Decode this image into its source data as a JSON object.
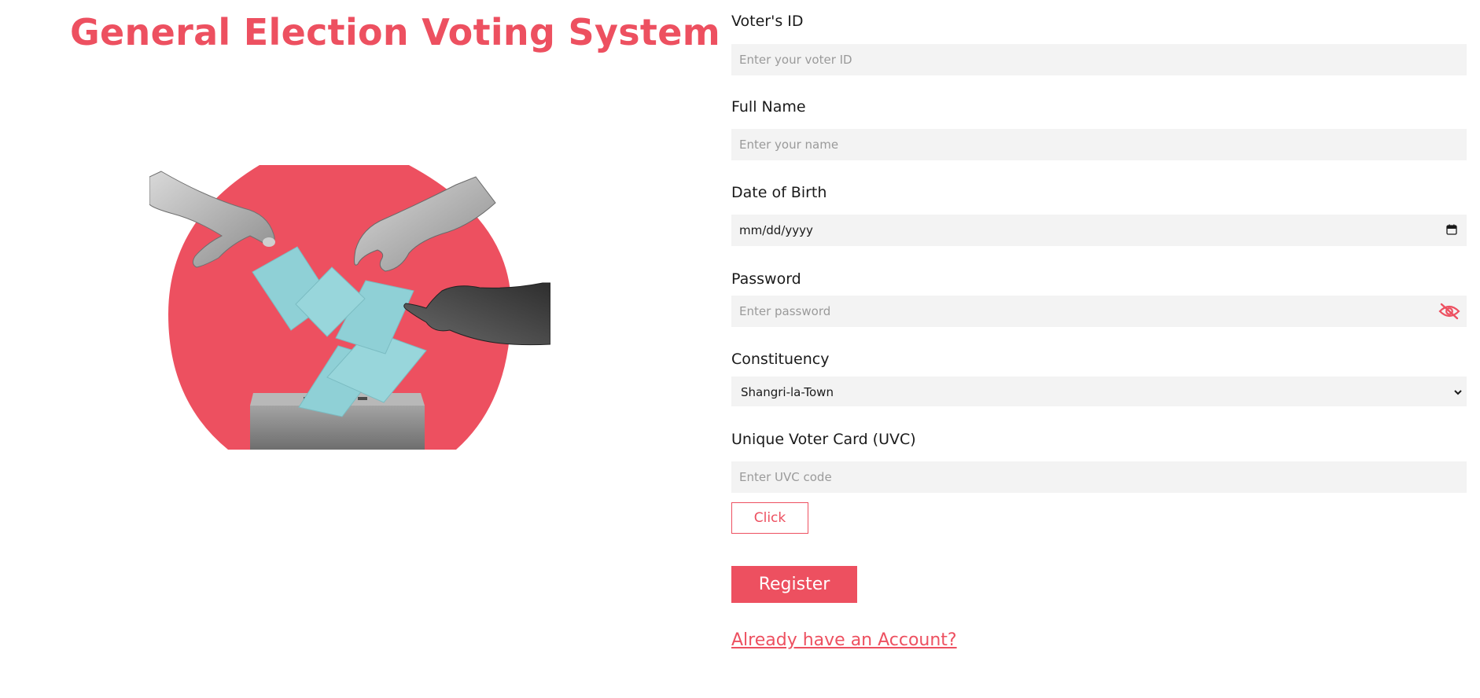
{
  "app": {
    "title": "General Election Voting System"
  },
  "form": {
    "voter_id": {
      "label": "Voter's ID",
      "placeholder": "Enter your voter ID",
      "value": ""
    },
    "full_name": {
      "label": "Full Name",
      "placeholder": "Enter your name",
      "value": ""
    },
    "dob": {
      "label": "Date of Birth",
      "placeholder": "mm/dd/yyyy"
    },
    "password": {
      "label": "Password",
      "placeholder": "Enter password",
      "value": ""
    },
    "constituency": {
      "label": "Constituency",
      "selected": "Shangri-la-Town"
    },
    "uvc": {
      "label": "Unique Voter Card (UVC)",
      "placeholder": "Enter UVC code",
      "value": ""
    },
    "click_label": "Click",
    "register_label": "Register",
    "login_link": "Already have an Account?"
  },
  "icons": {
    "calendar": "calendar-icon",
    "password_toggle": "eye-off-icon",
    "dropdown": "chevron-down-icon"
  },
  "colors": {
    "accent": "#ed5060",
    "field_bg": "#f3f3f3",
    "ballot": "#8fd0d6",
    "box": "#8a8a8a"
  }
}
